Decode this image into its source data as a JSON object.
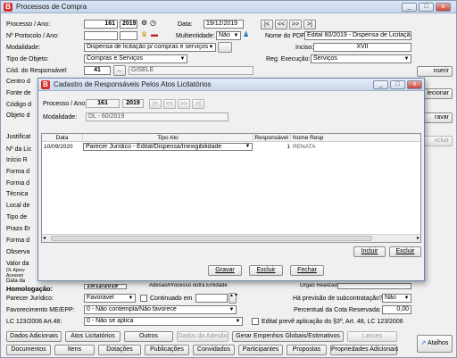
{
  "window": {
    "title": "Processos de Compra",
    "app_icon": "B",
    "controls": [
      "_",
      "□",
      "x"
    ]
  },
  "form": {
    "processo_label": "Processo / Ano:",
    "processo_num": "161",
    "processo_ano": "2019",
    "data_label": "Data:",
    "data_value": "19/12/2019",
    "nav": [
      "|<",
      "<<",
      ">>",
      ">|"
    ],
    "protocolo_label": "Nº Protocolo / Ano:",
    "multientidade_label": "Multientidade:",
    "multientidade_value": "Não",
    "nome_pdf_label": "Nome do PDF:",
    "nome_pdf_value": "Edital 60/2019 - Dispensa de Licitação",
    "modalidade_label": "Modalidade:",
    "modalidade_value": "Dispensa de licitação p/ compras e serviços",
    "inciso_label": "Inciso:",
    "inciso_value": "XVII",
    "tipo_objeto_label": "Tipo de Objeto:",
    "tipo_objeto_value": "Compras e Serviços",
    "reg_execucao_label": "Reg. Execução:",
    "reg_execucao_value": "Serviços",
    "cod_resp_label": "Cód. do Responsável:",
    "cod_resp_value": "41",
    "cod_resp_btn": "...",
    "cod_resp_name": "GISELE",
    "side_labels": [
      "Centro d",
      "Fonte de",
      "Código d",
      "Objeto d",
      "Justificat",
      "Nº da Lic",
      "Início R",
      "Forma d",
      "Forma d",
      "Técnica",
      "Local de",
      "Tipo de",
      "Prazo Er",
      "Forma d",
      "Observa",
      "Valor da",
      "Dt. Aprov",
      "Acessori",
      "Data da"
    ],
    "right_buttons": [
      "nserir",
      "lecionar",
      "ravar",
      "xcluir"
    ],
    "homologacao_label": "Homologação:",
    "homologacao_date": "15/12/2019",
    "adesao_label": "Adesão/Processo outra Entidade",
    "orgao_label": "Órgão Realizador",
    "parecer_label": "Parecer Jurídico:",
    "parecer_value": "Favorável",
    "continuado_label": "Continuado em",
    "subcontratacao_label": "Há previsão de subcontratação?:",
    "subcontratacao_value": "Não",
    "favorecimento_label": "Favorecimento ME/EPP:",
    "favorecimento_value": "0 - Não contempla/Não favorece",
    "percentual_label": "Percentual da Cota Reservada:",
    "percentual_value": "0,00",
    "lc_label": "LC 123/2006 Art.48:",
    "lc_value": "0 - Não se aplica",
    "edital_label": "Edital prevê aplicação do §3º, Art. 48, LC 123/2006"
  },
  "bottom_row1": [
    {
      "label": "Dados Adicionais",
      "disabled": false
    },
    {
      "label": "Atos Licitatórios",
      "disabled": false
    },
    {
      "label": "Outros",
      "disabled": false
    },
    {
      "label": "Dados da Adesão",
      "disabled": true
    },
    {
      "label": "Gerar Empenhos Globais/Estimativos",
      "disabled": false
    },
    {
      "label": "Lances",
      "disabled": true
    }
  ],
  "bottom_row2": [
    {
      "label": "Documentos",
      "disabled": false
    },
    {
      "label": "Itens",
      "disabled": false
    },
    {
      "label": "Dotações",
      "disabled": false
    },
    {
      "label": "Publicações",
      "disabled": false
    },
    {
      "label": "Convidados",
      "disabled": false
    },
    {
      "label": "Participantes",
      "disabled": false
    },
    {
      "label": "Propostas",
      "disabled": false
    },
    {
      "label": "Propriedades Adicionais",
      "disabled": false
    }
  ],
  "atalhos_label": "Atalhos",
  "dialog": {
    "title": "Cadastro de Responsáveis Pelos Atos Licitatórios",
    "processo_label": "Processo / Ano:",
    "processo_num": "161",
    "processo_ano": "2019",
    "modalidade_label": "Modalidade:",
    "modalidade_value": "DL - 60/2019",
    "grid_headers": [
      "Data",
      "Tipo Ato",
      "Responsável",
      "Nome Resp"
    ],
    "grid_rows": [
      {
        "data": "10/09/2020",
        "tipo_ato": "Parecer Jurídico - Edital/Dispensa/Inexigibilidade",
        "responsavel": "1",
        "nome_resp": "RENATA"
      }
    ],
    "incluir_label": "Incluir",
    "excluir_label": "Excluir",
    "gravar_label": "Gravar",
    "excluir2_label": "Excluir",
    "fechar_label": "Fechar"
  }
}
